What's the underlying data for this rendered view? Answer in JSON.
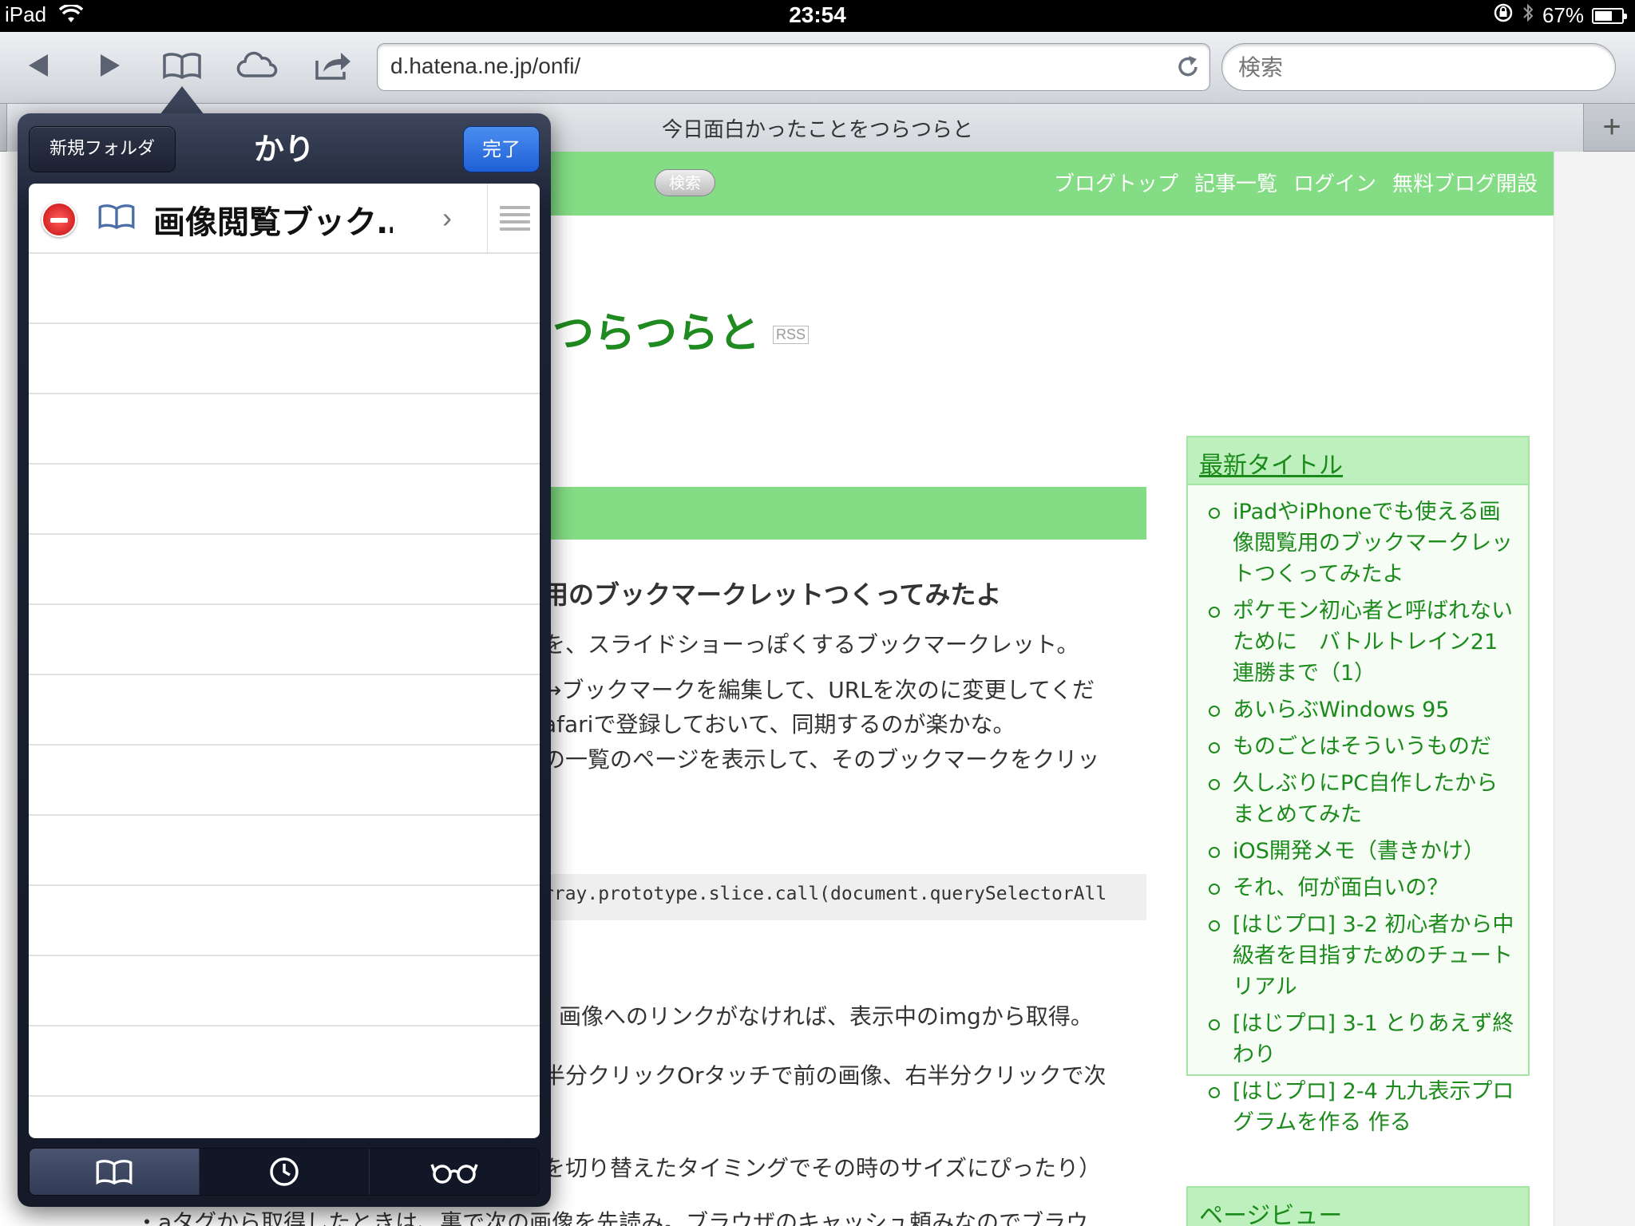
{
  "status_bar": {
    "device": "iPad",
    "time": "23:54",
    "battery": "67%",
    "battery_level": 0.67
  },
  "toolbar": {
    "url": "d.hatena.ne.jp/onfi/",
    "search_placeholder": "検索"
  },
  "tab": {
    "title": "今日面白かったことをつらつらと",
    "new_tab_label": "+"
  },
  "page": {
    "header_search": "検索",
    "nav_links": [
      "ブログトップ",
      "記事一覧",
      "ログイン",
      "無料ブログ開設"
    ],
    "blog_title": "をつらつらと",
    "rss": "RSS",
    "entry_title": "用のブックマークレットつくってみたよ",
    "paragraphs": [
      "を、スライドショーっぽくするブックマークレット。",
      "→ブックマークを編集して、URLを次のに変更してくだ",
      "afariで登録しておいて、同期するのが楽かな。",
      "の一覧のページを表示して、そのブックマークをクリッ",
      "画像へのリンクがなければ、表示中のimgから取得。",
      "半分クリックOrタッチで前の画像、右半分クリックで次",
      "を切り替えたタイミングでその時のサイズにぴったり）",
      "・aタグから取得したときは、裏で次の画像を先読み。ブラウザのキャッシュ頼みなのでブラウ"
    ],
    "code": "rray.prototype.slice.call(document.querySelectorAll"
  },
  "sidebar": {
    "heading": "最新タイトル",
    "items": [
      "iPadやiPhoneでも使える画像閲覧用のブックマークレットつくってみたよ",
      "ポケモン初心者と呼ばれないために　バトルトレイン21連勝まで（1）",
      "あいらぶWindows 95",
      "ものごとはそういうものだ",
      "久しぶりにPC自作したからまとめてみた",
      "iOS開発メモ（書きかけ）",
      "それ、何が面白いの？",
      "[はじプロ] 3-2 初心者から中級者を目指すためのチュートリアル",
      "[はじプロ] 3-1 とりあえず終わり",
      "[はじプロ] 2-4 九九表示プログラムを作る 作る"
    ],
    "pageview_heading": "ページビュー"
  },
  "bookmarks_popover": {
    "new_folder_label": "新規フォルダ",
    "title": "かり",
    "done_label": "完了",
    "items": [
      {
        "title": "画像閲覧ブック…"
      }
    ],
    "tabs": [
      "bookmarks-icon",
      "history-icon",
      "reading-list-icon"
    ]
  },
  "colors": {
    "accent_green": "#84dd84",
    "link_green": "#1b8a1b",
    "done_blue": "#2a6fe0"
  }
}
